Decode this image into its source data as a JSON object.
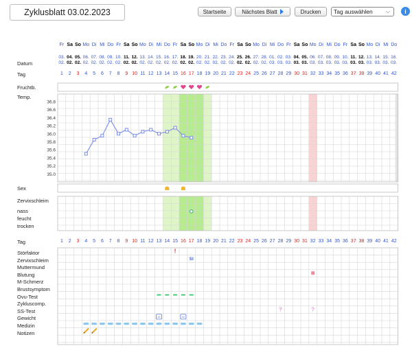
{
  "header": {
    "title": "Zyklusblatt 03.02.2023",
    "buttons": [
      "Startseite",
      "Nächstes Blatt",
      "Drucken"
    ],
    "select_value": "Tag auswählen",
    "info_symbol": "i"
  },
  "labels": {
    "datum": "Datum",
    "tag": "Tag",
    "fruchtb": "Fruchtb.",
    "temp": "Temp.",
    "sex": "Sex",
    "zervixschleim": "Zervixschleim",
    "zervix_levels": [
      "nass",
      "feucht",
      "trocken"
    ],
    "tag2": "Tag",
    "bottom_rows": [
      "Störfaktor",
      "Zervixschleim",
      "Muttermund",
      "Blutung",
      "M-Schmerz",
      "Brustsymptom",
      "Ovu-Test",
      "Zykluscomp.",
      "SS-Test",
      "Gewicht",
      "Medizin",
      "Notizen"
    ]
  },
  "weekdays": [
    "Fr",
    "Sa",
    "So",
    "Mo",
    "Di",
    "Mi",
    "Do",
    "Fr",
    "Sa",
    "So",
    "Mo",
    "Di",
    "Mi",
    "Do",
    "Fr",
    "Sa",
    "So",
    "Mo",
    "Di",
    "Mi",
    "Do",
    "Fr",
    "Sa",
    "So",
    "Mo",
    "Di",
    "Mi",
    "Do",
    "Fr",
    "Sa",
    "So",
    "Mo",
    "Di",
    "Mi",
    "Do",
    "Fr",
    "Sa",
    "So",
    "Mo",
    "Di",
    "Mi",
    "Do"
  ],
  "date_days": [
    "03.",
    "04.",
    "05.",
    "06.",
    "07.",
    "08.",
    "09.",
    "10.",
    "11.",
    "12.",
    "13.",
    "14.",
    "15.",
    "16.",
    "17.",
    "18.",
    "19.",
    "20.",
    "21.",
    "22.",
    "23.",
    "24.",
    "25.",
    "26.",
    "27.",
    "28.",
    "01.",
    "02.",
    "03.",
    "04.",
    "05.",
    "06.",
    "07.",
    "08.",
    "09.",
    "10.",
    "11.",
    "12.",
    "13.",
    "14.",
    "15.",
    "16."
  ],
  "date_months": [
    "02.",
    "02.",
    "02.",
    "02.",
    "02.",
    "02.",
    "02.",
    "02.",
    "02.",
    "02.",
    "02.",
    "02.",
    "02.",
    "02.",
    "02.",
    "02.",
    "02.",
    "02.",
    "02.",
    "02.",
    "02.",
    "02.",
    "02.",
    "02.",
    "02.",
    "02.",
    "03.",
    "03.",
    "03.",
    "03.",
    "03.",
    "03.",
    "03.",
    "03.",
    "03.",
    "03.",
    "03.",
    "03.",
    "03.",
    "03.",
    "03.",
    "03."
  ],
  "weekend_index": [
    1,
    2,
    8,
    9,
    15,
    16,
    22,
    23,
    29,
    30,
    36,
    37
  ],
  "day_numbers": [
    "1",
    "2",
    "3",
    "4",
    "5",
    "6",
    "7",
    "8",
    "9",
    "10",
    "11",
    "12",
    "13",
    "14",
    "15",
    "16",
    "17",
    "18",
    "19",
    "20",
    "21",
    "22",
    "23",
    "24",
    "25",
    "26",
    "27",
    "28",
    "29",
    "30",
    "31",
    "32",
    "33",
    "34",
    "35",
    "36",
    "37",
    "38",
    "39",
    "40",
    "41",
    "42"
  ],
  "colors": {
    "weekday_text": "#3355cc",
    "weekend_text": "#000000",
    "red_day": "#dd2222",
    "blue_day": "#3355cc",
    "fertile_light": "#dff5c8",
    "fertile_dark": "#b7eb8f",
    "period_band": "#f8d3d3",
    "temp_line": "#7b8ce8",
    "grid": "#d6d6d6"
  },
  "chart_data": {
    "type": "line",
    "title": "",
    "ylabel": "",
    "ytick_labels": [
      "36.8",
      "36.6",
      "36.4",
      "36.2",
      "36.0",
      "35.8",
      "35.6",
      "35.4",
      "35.2",
      "35.0"
    ],
    "ylim": [
      35.0,
      36.8
    ],
    "series": [
      {
        "values": [
          {
            "day": 4,
            "temp": 35.5
          },
          {
            "day": 5,
            "temp": 35.85
          },
          {
            "day": 6,
            "temp": 35.95
          },
          {
            "day": 7,
            "temp": 36.35
          },
          {
            "day": 8,
            "temp": 36.0
          },
          {
            "day": 9,
            "temp": 36.1
          },
          {
            "day": 10,
            "temp": 35.95
          },
          {
            "day": 11,
            "temp": 36.05
          },
          {
            "day": 12,
            "temp": 36.1
          },
          {
            "day": 13,
            "temp": 36.0
          },
          {
            "day": 14,
            "temp": 36.05
          },
          {
            "day": 15,
            "temp": 36.15
          },
          {
            "day": 16,
            "temp": 35.95
          },
          {
            "day": 17,
            "temp": 35.9
          }
        ]
      }
    ]
  },
  "fertile_window_days": [
    14,
    19
  ],
  "peak_days": [
    16,
    18
  ],
  "period_day": 32,
  "fruchtb_symbols": [
    {
      "day": 14,
      "symbol": "leaf"
    },
    {
      "day": 15,
      "symbol": "leaf"
    },
    {
      "day": 16,
      "symbol": "heart"
    },
    {
      "day": 17,
      "symbol": "heart"
    },
    {
      "day": 18,
      "symbol": "heart"
    },
    {
      "day": 19,
      "symbol": "leaf"
    }
  ],
  "sex_days": [
    14,
    16
  ],
  "zervix_point": {
    "day": 17,
    "level": "feucht"
  },
  "bottom_marks": {
    "stoerfaktor": {
      "day": 15,
      "text": "!"
    },
    "zervixschleim": {
      "day": 17,
      "text": "SI"
    },
    "blutung_day": 32,
    "ovu_days": [
      13,
      14,
      15,
      16,
      17
    ],
    "ss_test": [
      {
        "day": 28,
        "text": "?"
      },
      {
        "day": 32,
        "text": "?"
      }
    ],
    "gewicht_days": [
      13,
      16
    ],
    "medizin_days": [
      4,
      5,
      6,
      7,
      8,
      9,
      10,
      11,
      12,
      13,
      14,
      15,
      16,
      17,
      18
    ],
    "notizen_days": [
      4,
      5
    ]
  }
}
